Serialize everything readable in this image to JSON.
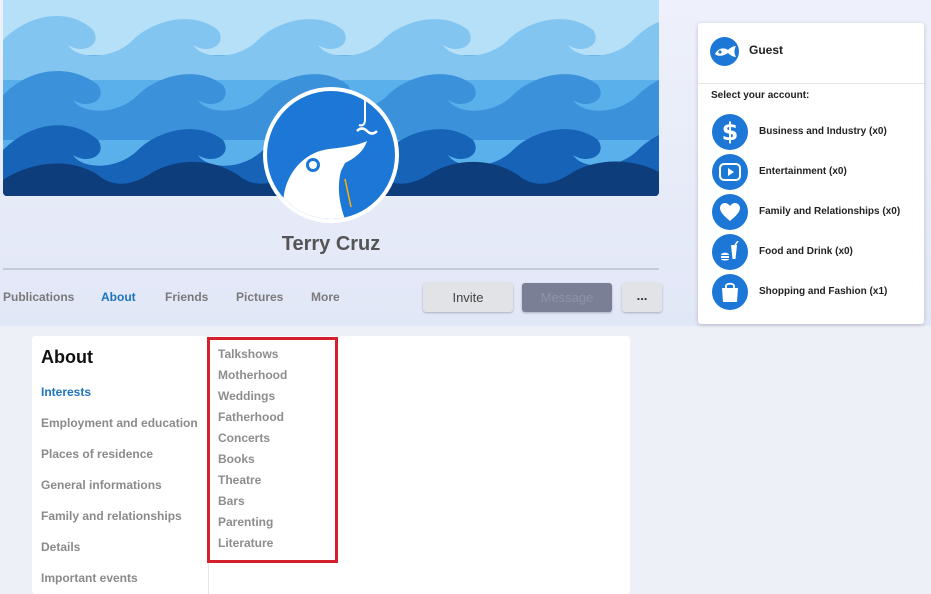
{
  "profile": {
    "name": "Terry Cruz",
    "tabs": [
      {
        "label": "Publications"
      },
      {
        "label": "About"
      },
      {
        "label": "Friends"
      },
      {
        "label": "Pictures"
      },
      {
        "label": "More"
      }
    ],
    "active_tab": "About",
    "buttons": {
      "invite": "Invite",
      "message": "Message",
      "more": "..."
    }
  },
  "account_panel": {
    "user": "Guest",
    "prompt": "Select your account:",
    "accounts": [
      {
        "label": "Business and Industry (x0)",
        "icon": "dollar-icon"
      },
      {
        "label": "Entertainment (x0)",
        "icon": "video-play-icon"
      },
      {
        "label": "Family and Relationships (x0)",
        "icon": "heart-icon"
      },
      {
        "label": "Food and Drink (x0)",
        "icon": "fast-food-icon"
      },
      {
        "label": "Shopping and Fashion (x1)",
        "icon": "shopping-bag-icon"
      }
    ]
  },
  "about": {
    "title": "About",
    "nav": [
      {
        "label": "Interests"
      },
      {
        "label": "Employment and education"
      },
      {
        "label": "Places of residence"
      },
      {
        "label": "General informations"
      },
      {
        "label": "Family and relationships"
      },
      {
        "label": "Details"
      },
      {
        "label": "Important events"
      }
    ],
    "active_nav": "Interests",
    "interests": [
      "Talkshows",
      "Motherhood",
      "Weddings",
      "Fatherhood",
      "Concerts",
      "Books",
      "Theatre",
      "Bars",
      "Parenting",
      "Literature"
    ]
  },
  "colors": {
    "accent": "#1e73be",
    "brand_blue": "#1d77d6",
    "highlight": "#d4202c",
    "wave_light": "#a6d5f5",
    "wave_mid": "#2e86d6",
    "wave_dark": "#0d3d7a"
  }
}
